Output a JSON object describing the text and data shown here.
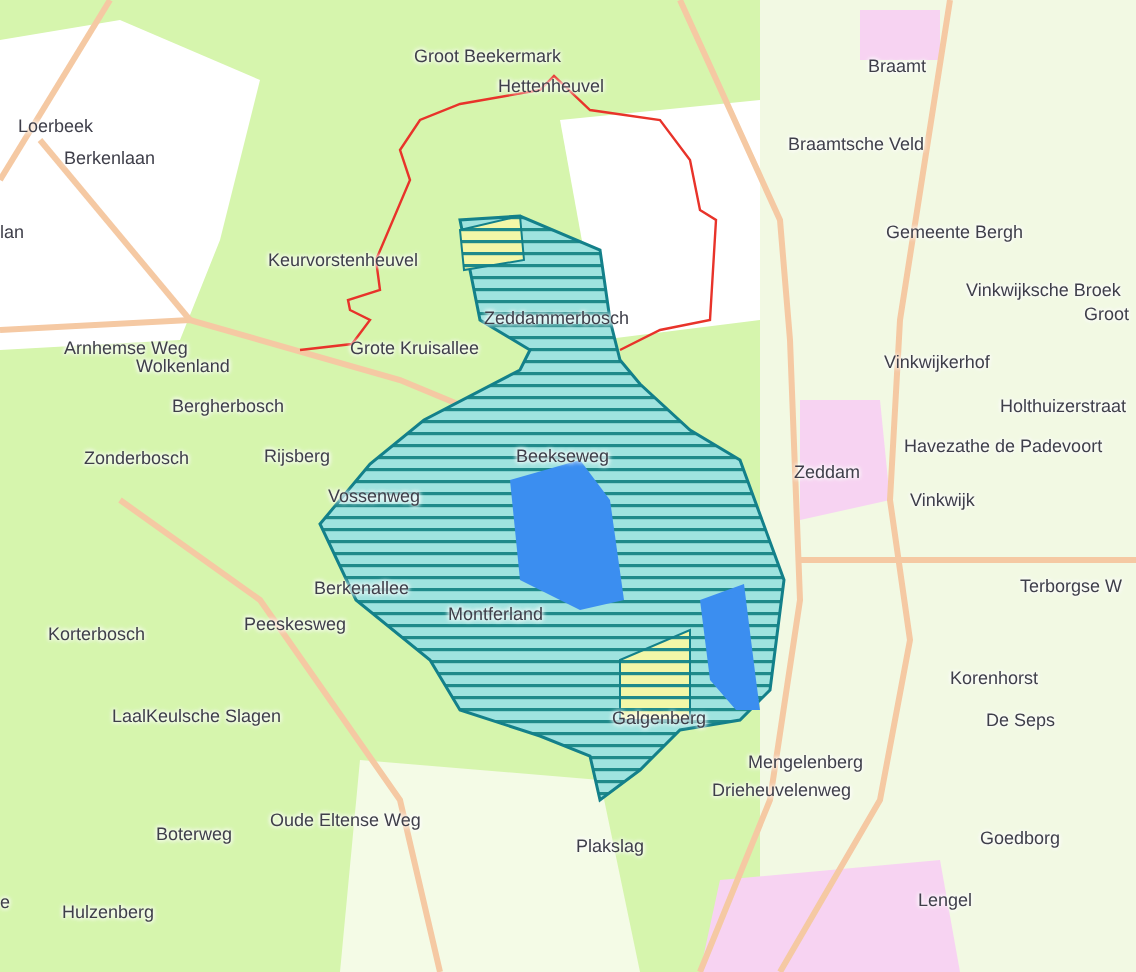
{
  "map": {
    "labels": [
      "Groot Beekermark",
      "Hettenheuvel",
      "Loerbeek",
      "Berkenlaan",
      "lan",
      "Keurvorstenheuvel",
      "Zeddammerbosch",
      "Arnhemse Weg",
      "Grote Kruisallee",
      "Wolkenland",
      "Bergherbosch",
      "Zonderbosch",
      "Rijsberg",
      "Beekseweg",
      "Vossenweg",
      "Braamt",
      "Braamtsche Veld",
      "Gemeente Bergh",
      "Vinkwijksche Broek",
      "Groot",
      "Vinkwijkerhof",
      "Holthuizerstraat",
      "Havezathe de Padevoort",
      "Zeddam",
      "Vinkwijk",
      "Terborgse W",
      "Berkenallee",
      "Korterbosch",
      "Peeskesweg",
      "Montferland",
      "Korenhorst",
      "Galgenberg",
      "De Seps",
      "Mengelenberg",
      "Drieheuvelenweg",
      "LaalKeulsche Slagen",
      "Boterweg",
      "Oude Eltense Weg",
      "Plakslag",
      "Goedborg",
      "Hulzenberg",
      "Lengel",
      "e"
    ]
  }
}
